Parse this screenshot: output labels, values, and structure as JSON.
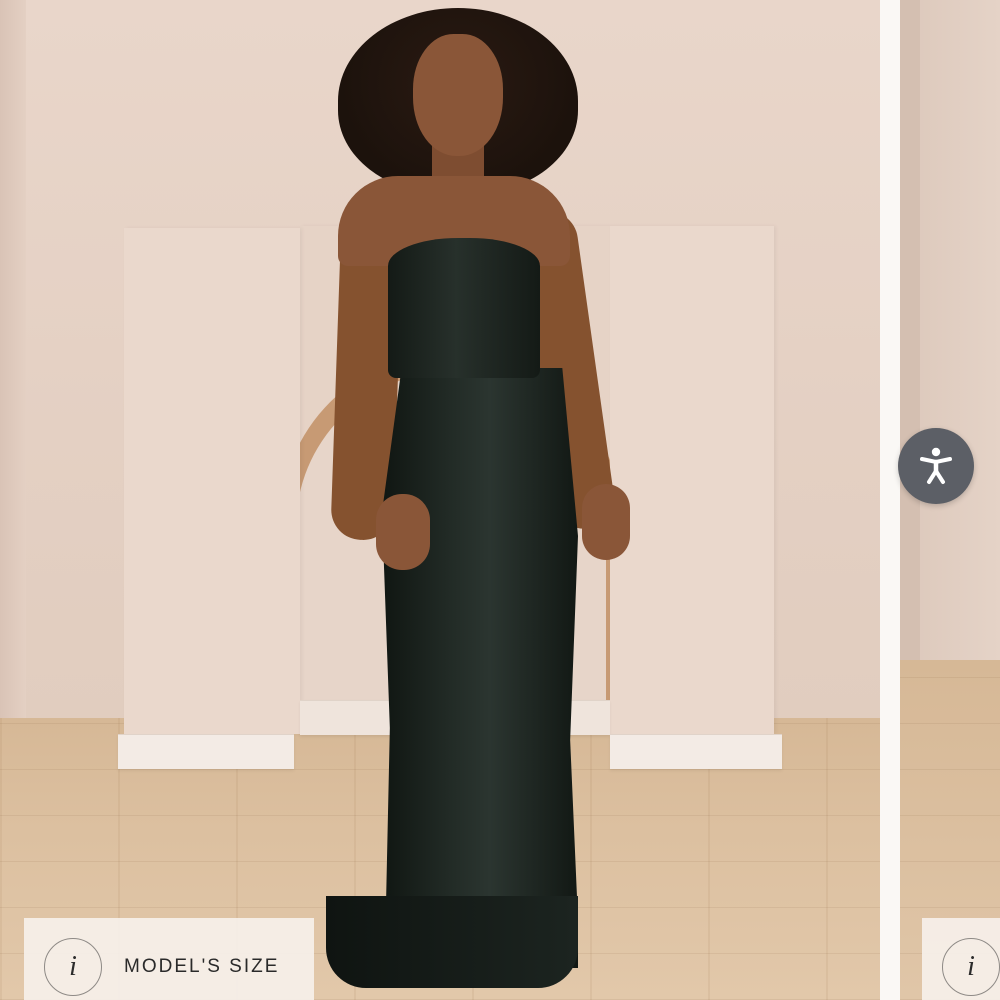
{
  "gallery": {
    "model_size_label": "MODEL'S SIZE",
    "info_glyph": "i"
  },
  "accessibility": {
    "icon": "accessibility-person-icon",
    "button_color": "#5c5f66"
  },
  "colors": {
    "wall": "#e6d3c7",
    "floor": "#dcc0a0",
    "gown": "#1c2420",
    "chip_background": "#f6f0ea"
  }
}
